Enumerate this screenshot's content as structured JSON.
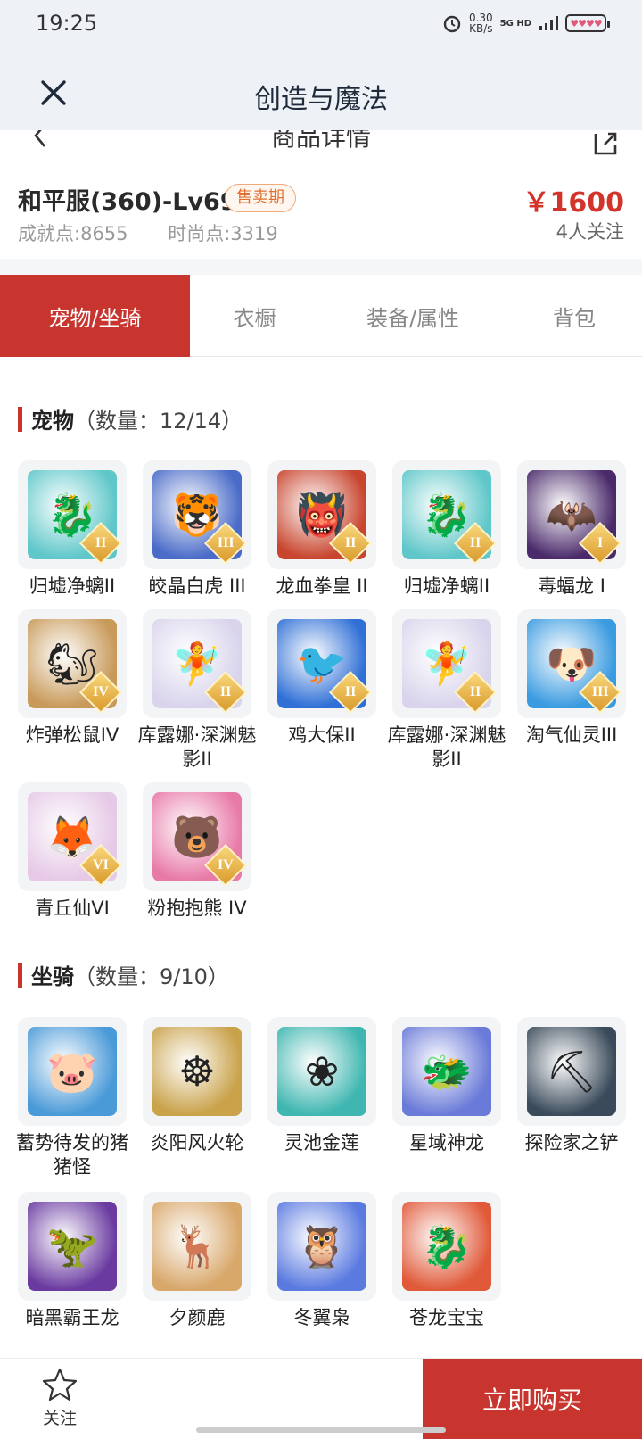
{
  "status_bar": {
    "time": "19:25",
    "net_speed_value": "0.30",
    "net_speed_unit": "KB/s",
    "network": "5G HD",
    "battery": "♥♥♥♥"
  },
  "nav": {
    "title": "创造与魔法",
    "subtitle": "商品详情"
  },
  "product": {
    "name": "和平服(360)-Lv69",
    "badge": "售卖期",
    "achievement_label": "成就点:",
    "achievement_value": "8655",
    "fashion_label": "时尚点:",
    "fashion_value": "3319",
    "price": "￥1600",
    "followers": "4人关注"
  },
  "tabs": [
    "宠物/坐骑",
    "衣橱",
    "装备/属性",
    "背包"
  ],
  "pets": {
    "title": "宠物",
    "count": "（数量：12/14）",
    "items": [
      {
        "name": "归墟净螭II",
        "grade": "II",
        "icon": "dragon-icon",
        "color": "#5fc7c9"
      },
      {
        "name": "皎晶白虎 III",
        "grade": "III",
        "icon": "tiger-icon",
        "color": "#4a6bc8"
      },
      {
        "name": "龙血拳皇 II",
        "grade": "II",
        "icon": "ogre-icon",
        "color": "#c8452e"
      },
      {
        "name": "归墟净螭II",
        "grade": "II",
        "icon": "dragon-icon",
        "color": "#5fc7c9"
      },
      {
        "name": "毒蝠龙 I",
        "grade": "I",
        "icon": "bat-dragon-icon",
        "color": "#4a2a6a"
      },
      {
        "name": "炸弹松鼠IV",
        "grade": "IV",
        "icon": "squirrel-icon",
        "color": "#c89a5a"
      },
      {
        "name": "库露娜·深渊魅影II",
        "grade": "II",
        "icon": "fairy-icon",
        "color": "#d9d4ec"
      },
      {
        "name": "鸡大保II",
        "grade": "II",
        "icon": "bird-icon",
        "color": "#2f6fd6"
      },
      {
        "name": "库露娜·深渊魅影II",
        "grade": "II",
        "icon": "fairy-icon",
        "color": "#d9d4ec"
      },
      {
        "name": "淘气仙灵III",
        "grade": "III",
        "icon": "puppy-icon",
        "color": "#3a9be0"
      },
      {
        "name": "青丘仙VI",
        "grade": "VI",
        "icon": "fox-fairy-icon",
        "color": "#e6c9e6"
      },
      {
        "name": "粉抱抱熊 IV",
        "grade": "IV",
        "icon": "bear-icon",
        "color": "#e87aa8"
      }
    ]
  },
  "mounts": {
    "title": "坐骑",
    "count": "（数量：9/10）",
    "items": [
      {
        "name": "蓄势待发的猪猪怪",
        "icon": "pig-icon",
        "color": "#4a9ad8"
      },
      {
        "name": "炎阳风火轮",
        "icon": "wheel-icon",
        "color": "#c9a24a"
      },
      {
        "name": "灵池金莲",
        "icon": "lotus-icon",
        "color": "#3fb6b0"
      },
      {
        "name": "星域神龙",
        "icon": "star-dragon-icon",
        "color": "#6a7ad8"
      },
      {
        "name": "探险家之铲",
        "icon": "shovel-icon",
        "color": "#3a4a5a"
      },
      {
        "name": "暗黑霸王龙",
        "icon": "trex-icon",
        "color": "#6a3aa0"
      },
      {
        "name": "夕颜鹿",
        "icon": "deer-icon",
        "color": "#d8a76a"
      },
      {
        "name": "冬翼枭",
        "icon": "owl-icon",
        "color": "#5a7ae0"
      },
      {
        "name": "苍龙宝宝",
        "icon": "baby-dragon-icon",
        "color": "#e05a3a"
      }
    ]
  },
  "bottom": {
    "follow": "关注",
    "buy": "立即购买"
  }
}
